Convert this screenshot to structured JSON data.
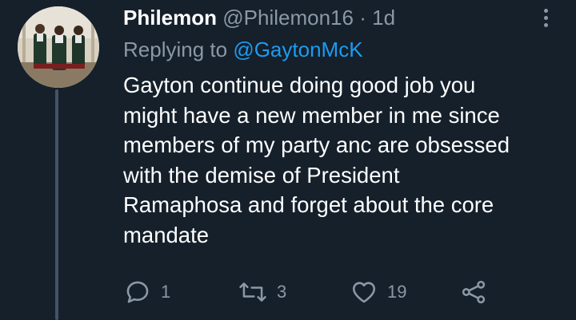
{
  "tweet": {
    "display_name": "Philemon",
    "handle": "@Philemon16",
    "separator": "·",
    "time": "1d",
    "replying_to_label": "Replying to",
    "replying_to_handle": "@GaytonMcK",
    "text": "Gayton continue doing good job you\nmight have a new member in me since\nmembers of my party anc are obsessed\nwith the demise of President\nRamaphosa and forget about the core\nmandate",
    "actions": {
      "reply_count": "1",
      "retweet_count": "3",
      "like_count": "19"
    }
  },
  "colors": {
    "background": "#15202b",
    "text_primary": "#ffffff",
    "text_secondary": "#8b98a5",
    "link": "#1d9bf0",
    "thread_line": "#425466"
  },
  "icons": {
    "more": "more-vertical-icon",
    "reply": "reply-icon",
    "retweet": "retweet-icon",
    "like": "heart-icon",
    "share": "share-icon"
  }
}
